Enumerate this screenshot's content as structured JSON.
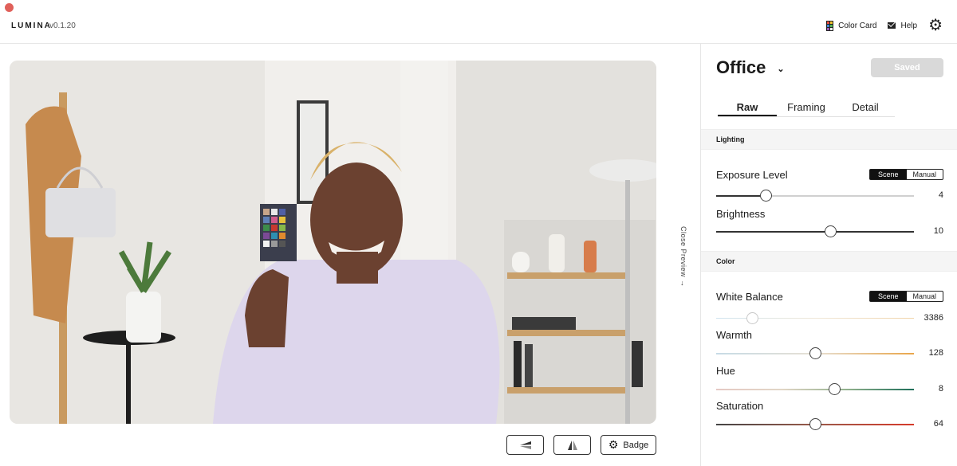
{
  "app": {
    "name": "LUMINA",
    "version": "v0.1.20"
  },
  "top_actions": {
    "color_card": "Color Card",
    "help": "Help"
  },
  "preview": {
    "close_label": "Close Preview",
    "buttons": {
      "badge_label": "Badge"
    }
  },
  "panel": {
    "preset": "Office",
    "saved_label": "Saved",
    "tabs": [
      "Raw",
      "Framing",
      "Detail"
    ],
    "sections": {
      "lighting": "Lighting",
      "color": "Color"
    },
    "mode_options": {
      "scene": "Scene",
      "manual": "Manual"
    },
    "controls": {
      "exposure": {
        "label": "Exposure Level",
        "value": "4",
        "fraction": 0.25,
        "mode": "Scene"
      },
      "brightness": {
        "label": "Brightness",
        "value": "10",
        "fraction": 0.575
      },
      "white_balance": {
        "label": "White Balance",
        "value": "3386",
        "fraction": 0.18,
        "mode": "Scene"
      },
      "warmth": {
        "label": "Warmth",
        "value": "128",
        "fraction": 0.5
      },
      "hue": {
        "label": "Hue",
        "value": "8",
        "fraction": 0.595
      },
      "saturation": {
        "label": "Saturation",
        "value": "64",
        "fraction": 0.5
      }
    }
  },
  "colors": {
    "accent": "#111111",
    "saved_bg": "#d9d9d9",
    "window_dot": "#e0605a"
  }
}
